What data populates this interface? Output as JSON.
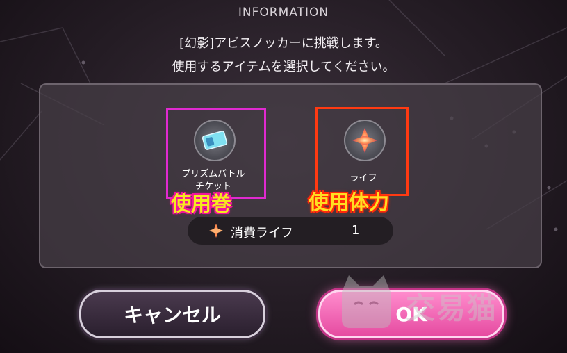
{
  "header": {
    "title": "INFORMATION"
  },
  "message": {
    "line1": "[幻影]アビスノッカーに挑戦します。",
    "line2": "使用するアイテムを選択してください。"
  },
  "items": [
    {
      "label_line1": "プリズムバトル",
      "label_line2": "チケット",
      "icon": "ticket-icon",
      "annotation": "使用巻",
      "highlight_color": "#e02ad0"
    },
    {
      "label_line1": "ライフ",
      "icon": "life-crystal-icon",
      "annotation": "使用体力",
      "highlight_color": "#ff3a12"
    }
  ],
  "cost": {
    "label": "消費ライフ",
    "value": "1",
    "icon": "life-crystal-icon"
  },
  "buttons": {
    "cancel_label": "キャンセル",
    "ok_label": "OK"
  },
  "watermark": {
    "text": "交易猫",
    "icon": "cat-logo"
  },
  "colors": {
    "ok_pink": "#ff8ccd",
    "cancel_dark": "#2a1f2e",
    "annotation_yellow": "#f5ea20"
  }
}
